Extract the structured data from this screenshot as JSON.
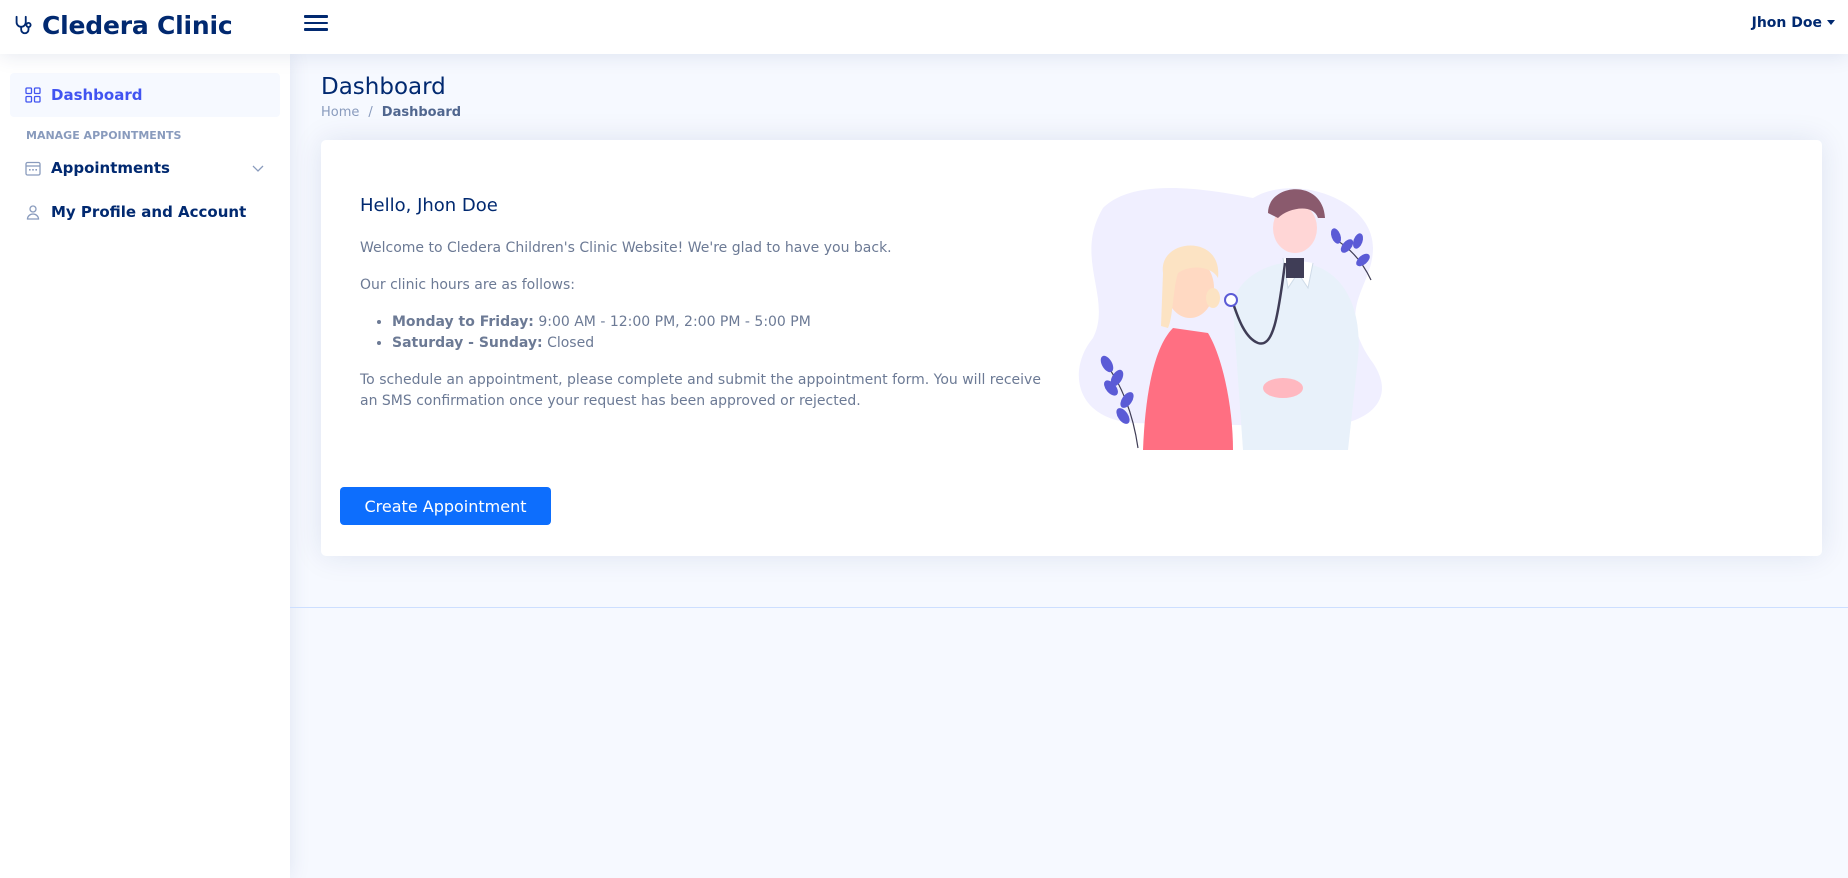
{
  "header": {
    "brand": "Cledera Clinic",
    "user_name": "Jhon Doe"
  },
  "sidebar": {
    "items": [
      {
        "label": "Dashboard",
        "icon": "grid-icon",
        "active": true
      },
      {
        "heading": "MANAGE APPOINTMENTS"
      },
      {
        "label": "Appointments",
        "icon": "calendar-icon"
      },
      {
        "label": "My Profile and Account",
        "icon": "person-icon"
      }
    ]
  },
  "page": {
    "title": "Dashboard",
    "breadcrumb": [
      "Home",
      "Dashboard"
    ]
  },
  "card": {
    "greeting": "Hello, Jhon Doe",
    "welcome": "Welcome to Cledera Children's Clinic Website! We're glad to have you back.",
    "hours_intro": "Our clinic hours are as follows:",
    "hours": [
      {
        "label": "Monday to Friday:",
        "value": "9:00 AM - 12:00 PM, 2:00 PM - 5:00 PM"
      },
      {
        "label": "Saturday - Sunday:",
        "value": "Closed"
      }
    ],
    "schedule_note": "To schedule an appointment, please complete and submit the appointment form. You will receive an SMS confirmation once your request has been approved or rejected.",
    "button": "Create Appointment"
  },
  "colors": {
    "primary": "#012970",
    "accent": "#4154f1",
    "button": "#0d6efd",
    "background": "#f6f9ff"
  }
}
